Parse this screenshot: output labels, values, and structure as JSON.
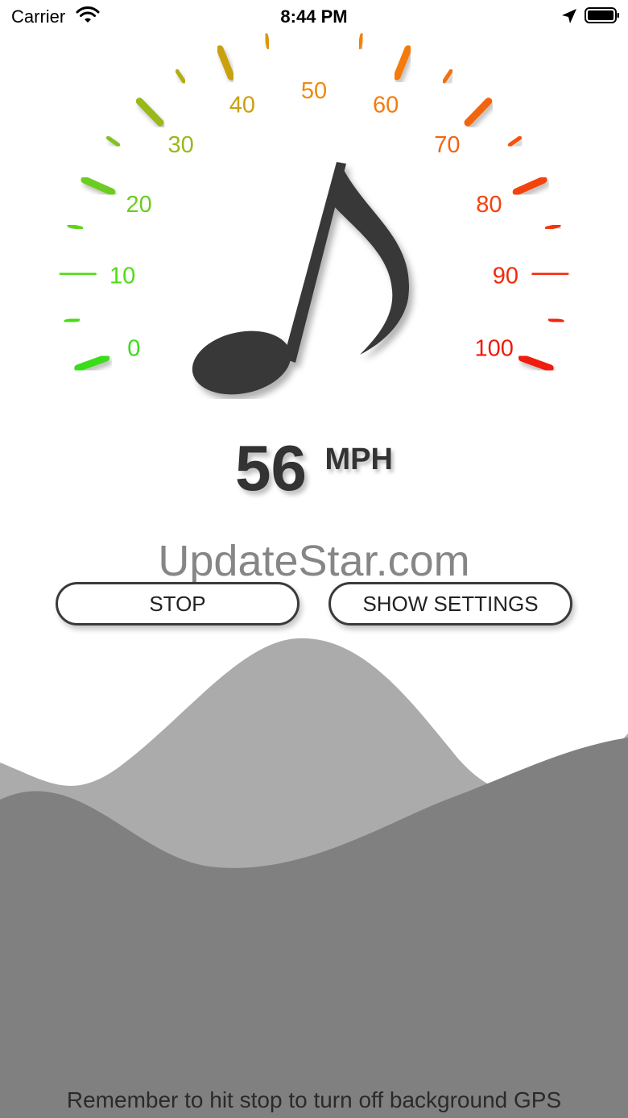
{
  "status_bar": {
    "carrier": "Carrier",
    "time": "8:44 PM"
  },
  "gauge": {
    "labels": [
      {
        "text": "0",
        "color": "#3bdc1a"
      },
      {
        "text": "10",
        "color": "#4fdc16"
      },
      {
        "text": "20",
        "color": "#6ccc22"
      },
      {
        "text": "30",
        "color": "#99b81c"
      },
      {
        "text": "40",
        "color": "#c9a110"
      },
      {
        "text": "50",
        "color": "#ef8a0a"
      },
      {
        "text": "60",
        "color": "#f47a0c"
      },
      {
        "text": "70",
        "color": "#f4640e"
      },
      {
        "text": "80",
        "color": "#f4420d"
      },
      {
        "text": "90",
        "color": "#f22a0a"
      },
      {
        "text": "100",
        "color": "#f01a08"
      }
    ]
  },
  "speed": {
    "value": "56",
    "unit": "MPH"
  },
  "watermark": "UpdateStar.com",
  "buttons": {
    "stop": "STOP",
    "settings": "SHOW SETTINGS"
  },
  "footer": "Remember to hit stop to turn off background GPS"
}
